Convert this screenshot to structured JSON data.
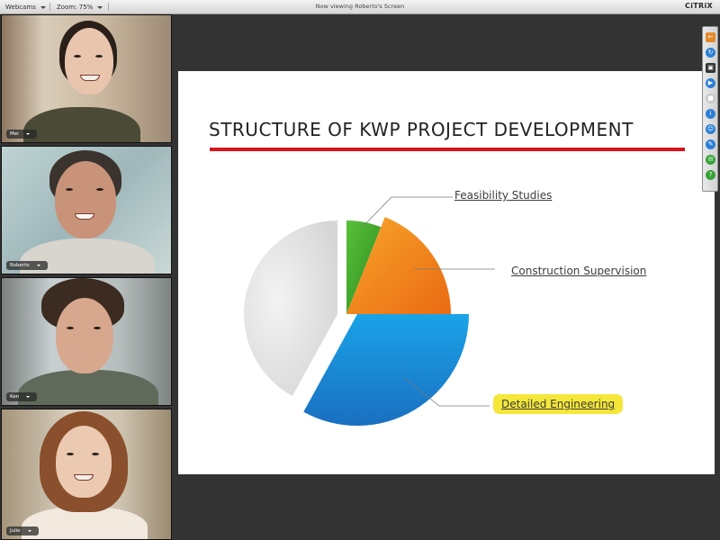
{
  "topbar": {
    "webcams_label": "Webcams",
    "zoom_label": "Zoom: 75%",
    "viewing_title": "Now viewing Roberto's Screen",
    "brand": "CiTRiX"
  },
  "participants": [
    {
      "name": "Mei"
    },
    {
      "name": "Roberto"
    },
    {
      "name": "Ken"
    },
    {
      "name": "Julie"
    }
  ],
  "slide": {
    "title": "STRUCTURE OF KWP PROJECT DEVELOPMENT"
  },
  "chart_data": {
    "type": "pie",
    "title": "STRUCTURE OF KWP PROJECT DEVELOPMENT",
    "slices": [
      {
        "label": "Feasibility Studies",
        "value": 6,
        "color": "#3fa32a",
        "exploded": true
      },
      {
        "label": "Construction Supervision",
        "value": 19,
        "color": "#f07f1b",
        "exploded": true
      },
      {
        "label": "Detailed Engineering",
        "value": 33,
        "color": "#1f8fd6",
        "exploded": true,
        "highlighted": true
      },
      {
        "label": "",
        "value": 42,
        "color": "#e3e3e3",
        "exploded": false
      }
    ],
    "highlight_color": "#f4e73a"
  },
  "toolbar": {
    "tools": [
      {
        "icon": "exit-icon",
        "color": "#e58a2a"
      },
      {
        "icon": "refresh-icon",
        "color": "#2b7fd6"
      },
      {
        "icon": "screen-share-icon",
        "color": "#333333"
      },
      {
        "icon": "play-icon",
        "color": "#2b7fd6"
      },
      {
        "icon": "stop-icon",
        "color": "#c8c8c8"
      },
      {
        "icon": "info-icon",
        "color": "#2b7fd6"
      },
      {
        "icon": "attendees-icon",
        "color": "#2b7fd6"
      },
      {
        "icon": "draw-icon",
        "color": "#2b7fd6"
      },
      {
        "icon": "chat-icon",
        "color": "#36a336"
      },
      {
        "icon": "help-icon",
        "color": "#36a336"
      }
    ]
  }
}
